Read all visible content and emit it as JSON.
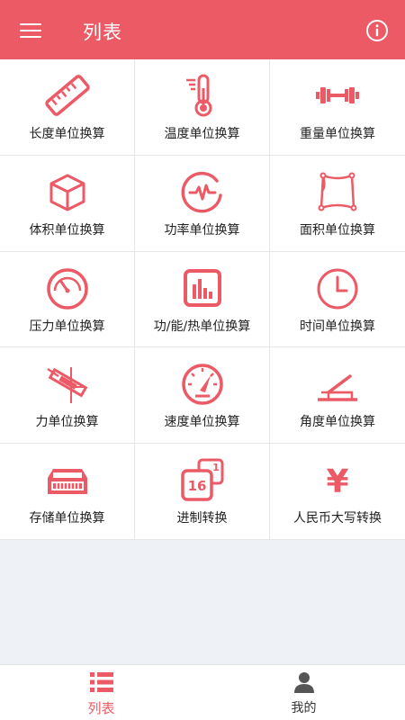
{
  "header": {
    "title": "列表"
  },
  "colors": {
    "accent": "#ec5a66"
  },
  "grid": {
    "items": [
      {
        "label": "长度单位换算",
        "icon": "ruler-icon"
      },
      {
        "label": "温度单位换算",
        "icon": "thermometer-icon"
      },
      {
        "label": "重量单位换算",
        "icon": "dumbbell-icon"
      },
      {
        "label": "体积单位换算",
        "icon": "cube-icon"
      },
      {
        "label": "功率单位换算",
        "icon": "pulse-icon"
      },
      {
        "label": "面积单位换算",
        "icon": "area-map-icon"
      },
      {
        "label": "压力单位换算",
        "icon": "gauge-icon"
      },
      {
        "label": "功/能/热单位换算",
        "icon": "bar-chart-icon"
      },
      {
        "label": "时间单位换算",
        "icon": "clock-icon"
      },
      {
        "label": "力单位换算",
        "icon": "force-icon"
      },
      {
        "label": "速度单位换算",
        "icon": "speedometer-icon"
      },
      {
        "label": "角度单位换算",
        "icon": "angle-icon"
      },
      {
        "label": "存储单位换算",
        "icon": "storage-icon"
      },
      {
        "label": "进制转换",
        "icon": "base-convert-icon",
        "badge": "16"
      },
      {
        "label": "人民币大写转换",
        "icon": "yuan-icon",
        "symbol": "¥"
      }
    ]
  },
  "tabs": [
    {
      "label": "列表",
      "icon": "list-icon",
      "active": true
    },
    {
      "label": "我的",
      "icon": "person-icon",
      "active": false
    }
  ]
}
